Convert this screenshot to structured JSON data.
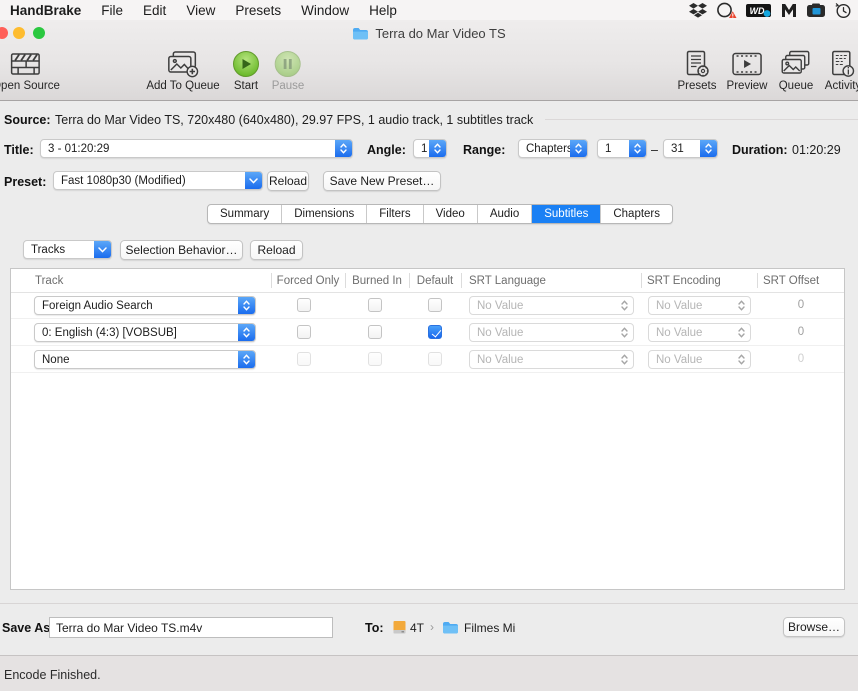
{
  "colors": {
    "accent_blue": "#1b6cee",
    "tab_selected": "#1a80f4",
    "window_bg": "#ececec",
    "start_green": "#6cba2c"
  },
  "menu_bar": {
    "app": "HandBrake",
    "items": [
      "File",
      "Edit",
      "View",
      "Presets",
      "Window",
      "Help"
    ],
    "status_icons": [
      "dropbox-icon",
      "creative-cloud-alert-icon",
      "wd-icon",
      "malwarebytes-icon",
      "camera-icon",
      "time-machine-icon"
    ]
  },
  "title_bar": {
    "title": "Terra do Mar Video TS"
  },
  "toolbar": {
    "open_source": "Open Source",
    "add_to_queue": "Add To Queue",
    "start": "Start",
    "pause": "Pause",
    "presets": "Presets",
    "preview": "Preview",
    "queue": "Queue",
    "activity": "Activity"
  },
  "source": {
    "label": "Source:",
    "value": "Terra do Mar Video TS, 720x480 (640x480), 29.97 FPS, 1 audio track, 1 subtitles track"
  },
  "title_row": {
    "title_label": "Title:",
    "title_value": "3 - 01:20:29",
    "angle_label": "Angle:",
    "angle_value": "1",
    "range_label": "Range:",
    "range_type": "Chapters",
    "range_from": "1",
    "range_dash": "–",
    "range_to": "31",
    "duration_label": "Duration:",
    "duration_value": "01:20:29"
  },
  "preset_row": {
    "label": "Preset:",
    "value": "Fast 1080p30 (Modified)",
    "reload": "Reload",
    "save_new": "Save New Preset…"
  },
  "tabs": [
    "Summary",
    "Dimensions",
    "Filters",
    "Video",
    "Audio",
    "Subtitles",
    "Chapters"
  ],
  "selected_tab": "Subtitles",
  "subtitles_panel": {
    "tracks_button": "Tracks",
    "selection_behavior": "Selection Behavior…",
    "reload": "Reload",
    "table": {
      "columns": [
        "Track",
        "Forced Only",
        "Burned In",
        "Default",
        "SRT Language",
        "SRT Encoding",
        "SRT Offset"
      ],
      "rows": [
        {
          "track": "Foreign Audio Search",
          "forced_only": false,
          "burned_in": false,
          "default": false,
          "srt_language": "No Value",
          "srt_encoding": "No Value",
          "srt_offset": "0",
          "checkboxes_enabled": true
        },
        {
          "track": "0: English (4:3) [VOBSUB]",
          "forced_only": false,
          "burned_in": false,
          "default": true,
          "srt_language": "No Value",
          "srt_encoding": "No Value",
          "srt_offset": "0",
          "checkboxes_enabled": true
        },
        {
          "track": "None",
          "forced_only": false,
          "burned_in": false,
          "default": false,
          "srt_language": "No Value",
          "srt_encoding": "No Value",
          "srt_offset": "0",
          "checkboxes_enabled": false
        }
      ]
    }
  },
  "destination": {
    "save_as_label": "Save As:",
    "filename": "Terra do Mar Video TS.m4v",
    "to_label": "To:",
    "drive": "4T",
    "path_separator": "›",
    "folder": "Filmes Mi",
    "browse": "Browse…"
  },
  "status_bar": {
    "text": "Encode Finished."
  }
}
